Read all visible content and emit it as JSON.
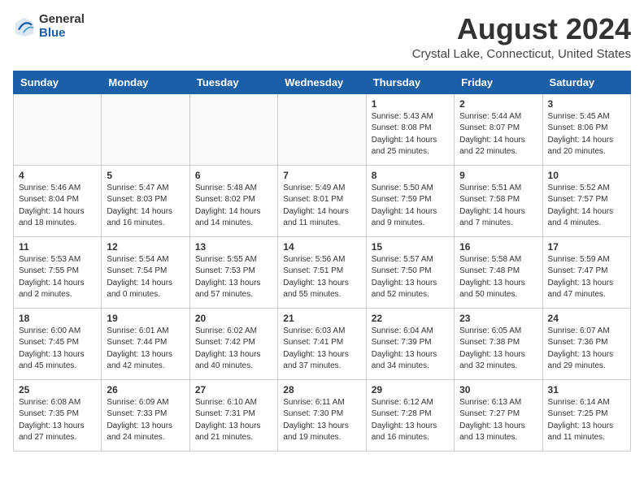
{
  "logo": {
    "general": "General",
    "blue": "Blue"
  },
  "title": "August 2024",
  "subtitle": "Crystal Lake, Connecticut, United States",
  "days_of_week": [
    "Sunday",
    "Monday",
    "Tuesday",
    "Wednesday",
    "Thursday",
    "Friday",
    "Saturday"
  ],
  "weeks": [
    [
      {
        "day": "",
        "info": ""
      },
      {
        "day": "",
        "info": ""
      },
      {
        "day": "",
        "info": ""
      },
      {
        "day": "",
        "info": ""
      },
      {
        "day": "1",
        "info": "Sunrise: 5:43 AM\nSunset: 8:08 PM\nDaylight: 14 hours\nand 25 minutes."
      },
      {
        "day": "2",
        "info": "Sunrise: 5:44 AM\nSunset: 8:07 PM\nDaylight: 14 hours\nand 22 minutes."
      },
      {
        "day": "3",
        "info": "Sunrise: 5:45 AM\nSunset: 8:06 PM\nDaylight: 14 hours\nand 20 minutes."
      }
    ],
    [
      {
        "day": "4",
        "info": "Sunrise: 5:46 AM\nSunset: 8:04 PM\nDaylight: 14 hours\nand 18 minutes."
      },
      {
        "day": "5",
        "info": "Sunrise: 5:47 AM\nSunset: 8:03 PM\nDaylight: 14 hours\nand 16 minutes."
      },
      {
        "day": "6",
        "info": "Sunrise: 5:48 AM\nSunset: 8:02 PM\nDaylight: 14 hours\nand 14 minutes."
      },
      {
        "day": "7",
        "info": "Sunrise: 5:49 AM\nSunset: 8:01 PM\nDaylight: 14 hours\nand 11 minutes."
      },
      {
        "day": "8",
        "info": "Sunrise: 5:50 AM\nSunset: 7:59 PM\nDaylight: 14 hours\nand 9 minutes."
      },
      {
        "day": "9",
        "info": "Sunrise: 5:51 AM\nSunset: 7:58 PM\nDaylight: 14 hours\nand 7 minutes."
      },
      {
        "day": "10",
        "info": "Sunrise: 5:52 AM\nSunset: 7:57 PM\nDaylight: 14 hours\nand 4 minutes."
      }
    ],
    [
      {
        "day": "11",
        "info": "Sunrise: 5:53 AM\nSunset: 7:55 PM\nDaylight: 14 hours\nand 2 minutes."
      },
      {
        "day": "12",
        "info": "Sunrise: 5:54 AM\nSunset: 7:54 PM\nDaylight: 14 hours\nand 0 minutes."
      },
      {
        "day": "13",
        "info": "Sunrise: 5:55 AM\nSunset: 7:53 PM\nDaylight: 13 hours\nand 57 minutes."
      },
      {
        "day": "14",
        "info": "Sunrise: 5:56 AM\nSunset: 7:51 PM\nDaylight: 13 hours\nand 55 minutes."
      },
      {
        "day": "15",
        "info": "Sunrise: 5:57 AM\nSunset: 7:50 PM\nDaylight: 13 hours\nand 52 minutes."
      },
      {
        "day": "16",
        "info": "Sunrise: 5:58 AM\nSunset: 7:48 PM\nDaylight: 13 hours\nand 50 minutes."
      },
      {
        "day": "17",
        "info": "Sunrise: 5:59 AM\nSunset: 7:47 PM\nDaylight: 13 hours\nand 47 minutes."
      }
    ],
    [
      {
        "day": "18",
        "info": "Sunrise: 6:00 AM\nSunset: 7:45 PM\nDaylight: 13 hours\nand 45 minutes."
      },
      {
        "day": "19",
        "info": "Sunrise: 6:01 AM\nSunset: 7:44 PM\nDaylight: 13 hours\nand 42 minutes."
      },
      {
        "day": "20",
        "info": "Sunrise: 6:02 AM\nSunset: 7:42 PM\nDaylight: 13 hours\nand 40 minutes."
      },
      {
        "day": "21",
        "info": "Sunrise: 6:03 AM\nSunset: 7:41 PM\nDaylight: 13 hours\nand 37 minutes."
      },
      {
        "day": "22",
        "info": "Sunrise: 6:04 AM\nSunset: 7:39 PM\nDaylight: 13 hours\nand 34 minutes."
      },
      {
        "day": "23",
        "info": "Sunrise: 6:05 AM\nSunset: 7:38 PM\nDaylight: 13 hours\nand 32 minutes."
      },
      {
        "day": "24",
        "info": "Sunrise: 6:07 AM\nSunset: 7:36 PM\nDaylight: 13 hours\nand 29 minutes."
      }
    ],
    [
      {
        "day": "25",
        "info": "Sunrise: 6:08 AM\nSunset: 7:35 PM\nDaylight: 13 hours\nand 27 minutes."
      },
      {
        "day": "26",
        "info": "Sunrise: 6:09 AM\nSunset: 7:33 PM\nDaylight: 13 hours\nand 24 minutes."
      },
      {
        "day": "27",
        "info": "Sunrise: 6:10 AM\nSunset: 7:31 PM\nDaylight: 13 hours\nand 21 minutes."
      },
      {
        "day": "28",
        "info": "Sunrise: 6:11 AM\nSunset: 7:30 PM\nDaylight: 13 hours\nand 19 minutes."
      },
      {
        "day": "29",
        "info": "Sunrise: 6:12 AM\nSunset: 7:28 PM\nDaylight: 13 hours\nand 16 minutes."
      },
      {
        "day": "30",
        "info": "Sunrise: 6:13 AM\nSunset: 7:27 PM\nDaylight: 13 hours\nand 13 minutes."
      },
      {
        "day": "31",
        "info": "Sunrise: 6:14 AM\nSunset: 7:25 PM\nDaylight: 13 hours\nand 11 minutes."
      }
    ]
  ]
}
